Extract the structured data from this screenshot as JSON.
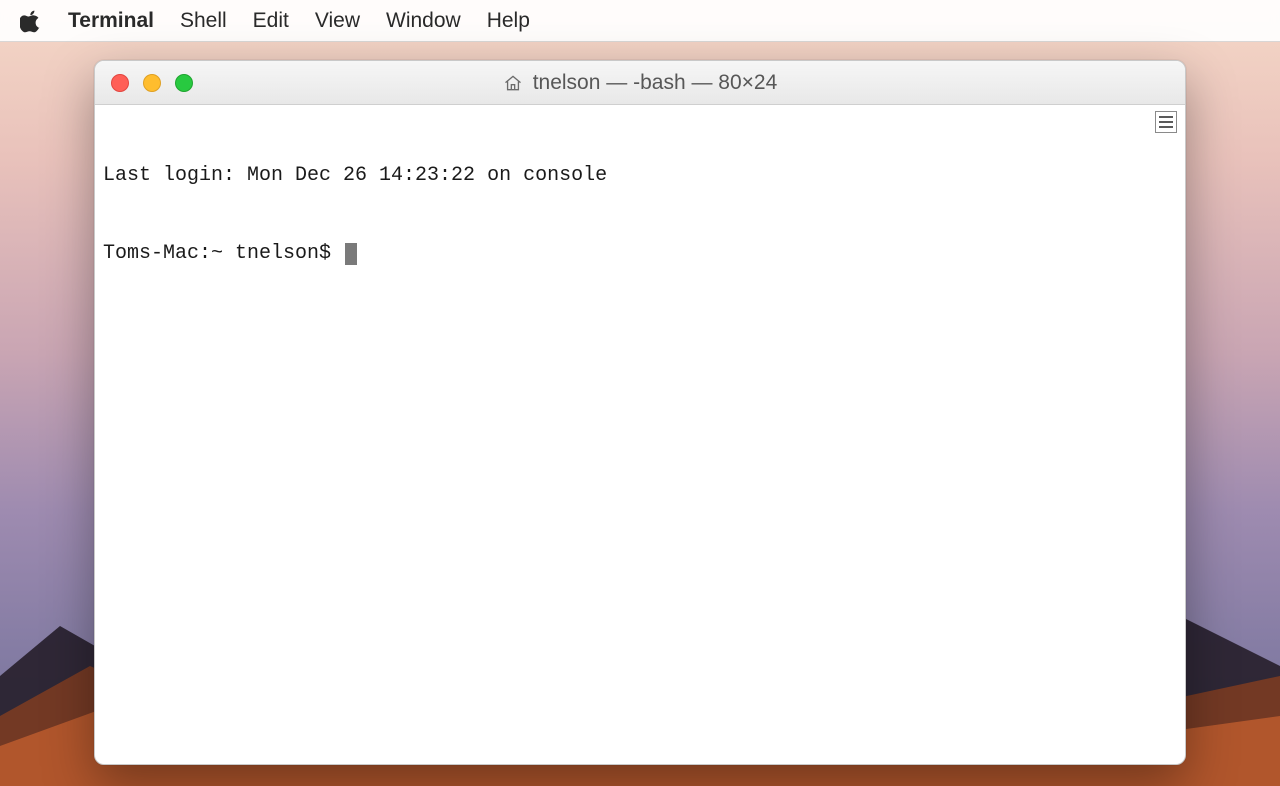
{
  "menubar": {
    "app_name": "Terminal",
    "items": [
      "Shell",
      "Edit",
      "View",
      "Window",
      "Help"
    ]
  },
  "window": {
    "title": "tnelson — -bash — 80×24",
    "home_icon": "home-icon"
  },
  "terminal": {
    "last_login_line": "Last login: Mon Dec 26 14:23:22 on console",
    "prompt": "Toms-Mac:~ tnelson$ "
  },
  "colors": {
    "traffic_close": "#ff5f57",
    "traffic_min": "#ffbd2e",
    "traffic_zoom": "#28c940"
  }
}
